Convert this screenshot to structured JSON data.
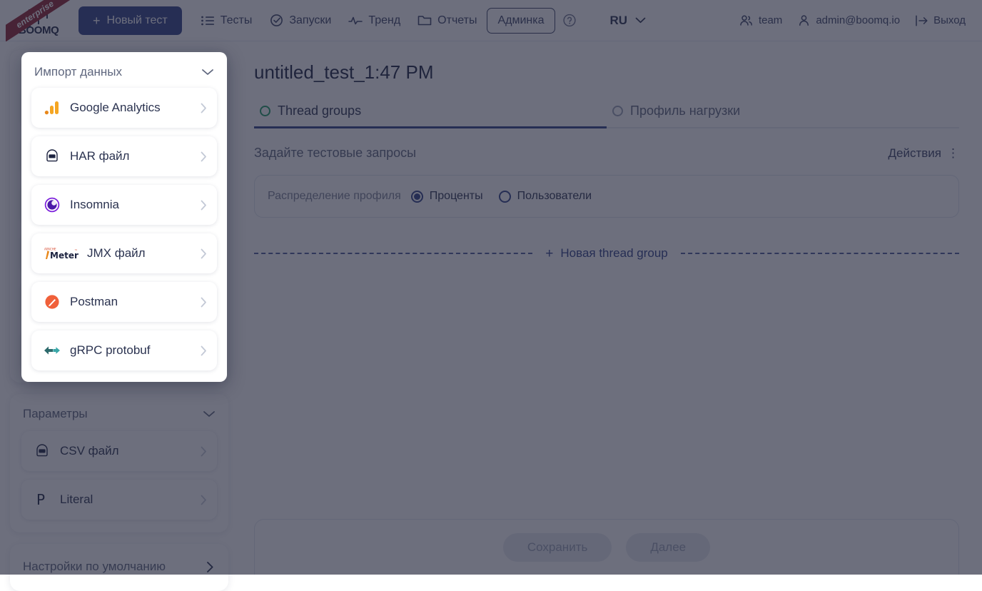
{
  "topbar": {
    "logo_text": "BOOMQ",
    "ribbon_label": "enterprise",
    "new_test_label": "Новый тест",
    "new_test_plus": "+",
    "nav": [
      {
        "label": "Тесты",
        "icon": "list-icon",
        "boxed": false
      },
      {
        "label": "Запуски",
        "icon": "check-circle-icon",
        "boxed": false
      },
      {
        "label": "Тренд",
        "icon": "pulse-icon",
        "boxed": false
      },
      {
        "label": "Отчеты",
        "icon": "folder-icon",
        "boxed": false
      },
      {
        "label": "Админка",
        "icon": "none",
        "boxed": true
      }
    ],
    "help_icon": "question-circle-icon",
    "language": {
      "label": "RU",
      "flag": "russia-flag-icon",
      "chevron": "chevron-down-icon"
    },
    "team_label": "team",
    "account_label": "admin@boomq.io",
    "logout_label": "Выход"
  },
  "modal": {
    "title": "Импорт данных",
    "collapse_icon": "chevron-down-icon",
    "items": [
      {
        "label": "Google Analytics",
        "icon": "google-analytics-icon"
      },
      {
        "label": "HAR файл",
        "icon": "har-file-icon"
      },
      {
        "label": "Insomnia",
        "icon": "insomnia-icon"
      },
      {
        "label": "JMX файл",
        "icon": "jmeter-icon"
      },
      {
        "label": "Postman",
        "icon": "postman-icon"
      },
      {
        "label": "gRPC protobuf",
        "icon": "grpc-icon"
      }
    ]
  },
  "sidebar": {
    "import_panel": {
      "title": "Импорт данных",
      "collapse_icon": "chevron-down-icon",
      "items": [
        {
          "label": "Google Analytics",
          "icon": "google-analytics-icon"
        },
        {
          "label": "HAR файл",
          "icon": "har-file-icon"
        },
        {
          "label": "Insomnia",
          "icon": "insomnia-icon"
        },
        {
          "label": "JMX файл",
          "icon": "jmeter-icon"
        },
        {
          "label": "Postman",
          "icon": "postman-icon"
        },
        {
          "label": "gRPC protobuf",
          "icon": "grpc-icon"
        }
      ]
    },
    "params_panel": {
      "title": "Параметры",
      "collapse_icon": "chevron-down-icon",
      "items": [
        {
          "label": "CSV файл",
          "icon": "csv-file-icon"
        },
        {
          "label": "Literal",
          "icon": "literal-p-icon"
        }
      ]
    },
    "defaults_panel": {
      "title": "Настройки по умолчанию",
      "arrow_icon": "chevron-right-icon"
    }
  },
  "main": {
    "page_title": "untitled_test_1:47 PM",
    "tabs": [
      {
        "label": "Thread groups",
        "active": true,
        "dot": "circle-outline-icon"
      },
      {
        "label": "Профиль нагрузки",
        "active": false,
        "dot": "circle-outline-icon"
      }
    ],
    "section_title": "Задайте тестовые запросы",
    "actions_label": "Действия",
    "actions_kebab": "⋮",
    "profile": {
      "label": "Распределение профиля",
      "options": [
        {
          "label": "Проценты",
          "selected": true
        },
        {
          "label": "Пользователи",
          "selected": false
        }
      ]
    },
    "new_thread_group": {
      "plus": "+",
      "label": "Новая thread group"
    },
    "footer": {
      "save_label": "Сохранить",
      "next_label": "Далее"
    }
  },
  "colors": {
    "brand": "#2f4188",
    "accent_green": "#1f9d63",
    "ribbon": "#8f2230",
    "scrim": "#21253a"
  }
}
